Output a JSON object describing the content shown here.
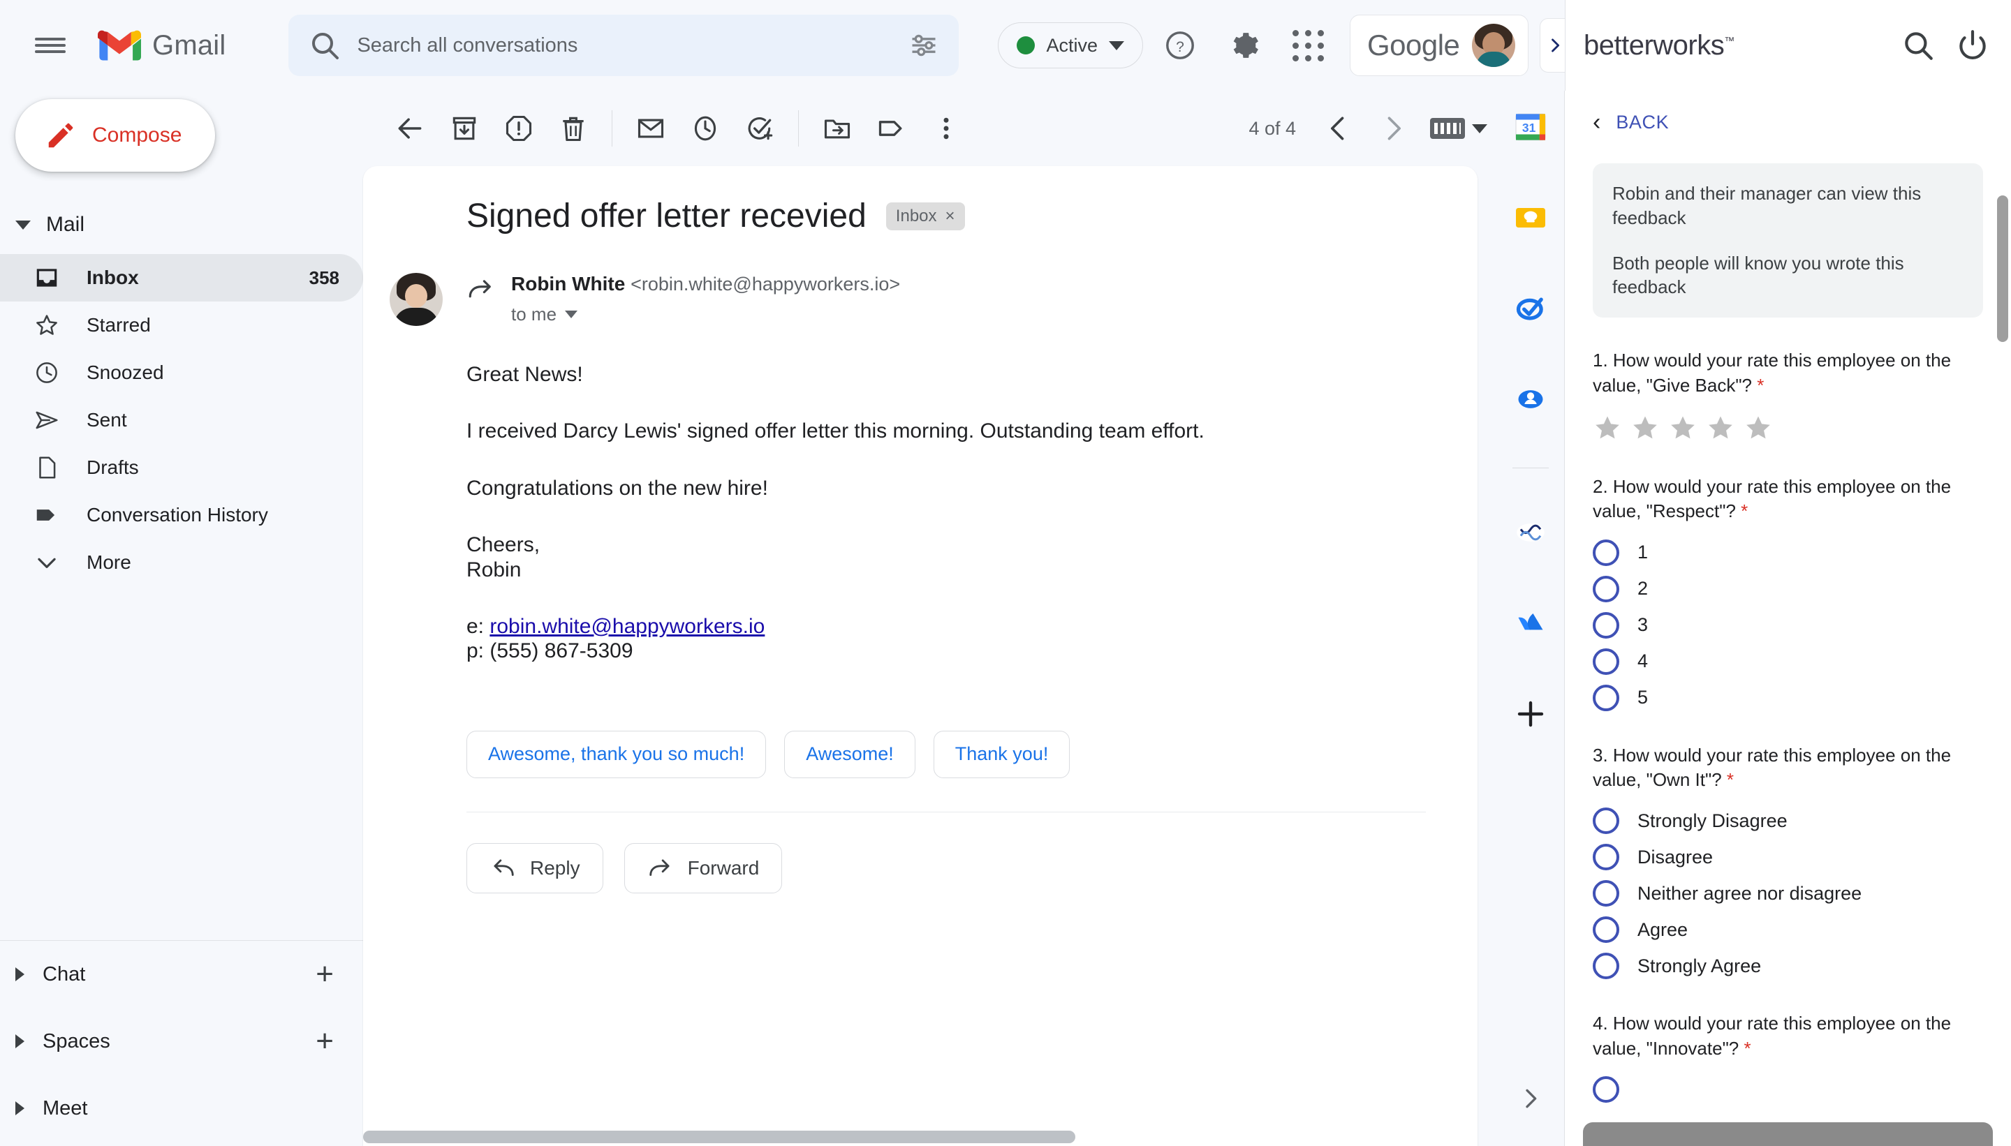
{
  "topbar": {
    "menu_icon": "hamburger-menu-icon",
    "logo_text": "Gmail",
    "search": {
      "icon": "search-icon",
      "placeholder": "Search all conversations",
      "value": "",
      "filter_icon": "tune-filter-icon"
    },
    "status": {
      "label": "Active",
      "color": "#1e8e3e",
      "caret": "chevron-down-icon"
    },
    "help_icon": "help-circle-icon",
    "settings_icon": "gear-icon",
    "apps_icon": "apps-grid-icon",
    "account": {
      "brand": "Google",
      "avatar": "user-avatar"
    },
    "panel_toggle_icon": "chevron-right-icon"
  },
  "sidebar": {
    "compose": {
      "label": "Compose",
      "icon": "pencil-icon"
    },
    "mail_section": {
      "label": "Mail",
      "expanded": true
    },
    "items": [
      {
        "label": "Inbox",
        "count": "358",
        "icon": "inbox-icon",
        "active": true
      },
      {
        "label": "Starred",
        "count": "",
        "icon": "star-icon",
        "active": false
      },
      {
        "label": "Snoozed",
        "count": "",
        "icon": "clock-icon",
        "active": false
      },
      {
        "label": "Sent",
        "count": "",
        "icon": "send-icon",
        "active": false
      },
      {
        "label": "Drafts",
        "count": "",
        "icon": "document-icon",
        "active": false
      },
      {
        "label": "Conversation History",
        "count": "",
        "icon": "label-tag-icon",
        "active": false
      },
      {
        "label": "More",
        "count": "",
        "icon": "chevron-down-icon",
        "active": false
      }
    ],
    "bottom_sections": [
      {
        "label": "Chat",
        "add_icon": "plus-icon",
        "has_add": true
      },
      {
        "label": "Spaces",
        "add_icon": "plus-icon",
        "has_add": true
      },
      {
        "label": "Meet",
        "add_icon": "",
        "has_add": false
      }
    ]
  },
  "mail_toolbar": {
    "back_icon": "arrow-left-icon",
    "archive_icon": "archive-icon",
    "spam_icon": "report-spam-icon",
    "delete_icon": "trash-icon",
    "mark_unread_icon": "envelope-icon",
    "snooze_icon": "clock-icon",
    "add_task_icon": "add-task-icon",
    "move_icon": "move-to-folder-icon",
    "label_icon": "label-tag-icon",
    "more_icon": "more-vertical-icon",
    "pager_text": "4 of 4",
    "prev_icon": "chevron-left-icon",
    "next_icon": "chevron-right-icon",
    "keyboard_icon": "keyboard-icon",
    "keyboard_caret": "chevron-down-icon"
  },
  "message": {
    "subject": "Signed offer letter recevied",
    "label_chip": "Inbox",
    "label_chip_close": "×",
    "sender_name": "Robin White",
    "sender_email": "<robin.white@happyworkers.io>",
    "recipient": "to me",
    "body": {
      "greeting": "Great News!",
      "paragraph": "I received Darcy Lewis' signed offer letter this morning. Outstanding team effort.",
      "congrats": "Congratulations on the new hire!",
      "signoff": "Cheers,",
      "signer": "Robin",
      "email_prefix": "e:",
      "email_link": "robin.white@happyworkers.io",
      "phone": "p: (555) 867-5309"
    },
    "smart_replies": [
      "Awesome, thank you so much!",
      "Awesome!",
      "Thank you!"
    ],
    "reply_button": "Reply",
    "forward_button": "Forward"
  },
  "app_rail": {
    "icons": [
      {
        "name": "google-calendar-icon",
        "label": "31"
      },
      {
        "name": "google-keep-icon",
        "label": ""
      },
      {
        "name": "google-tasks-icon",
        "label": ""
      },
      {
        "name": "google-contacts-icon",
        "label": ""
      },
      {
        "name": "betterworks-addon-icon",
        "label": ""
      },
      {
        "name": "atlassian-addon-icon",
        "label": ""
      },
      {
        "name": "add-addon-icon",
        "label": "+"
      }
    ],
    "expand_icon": "chevron-right-icon"
  },
  "side_panel": {
    "toggle_icon": "chevron-right-icon",
    "logo": "betterworks",
    "logo_tm": "™",
    "search_icon": "search-icon",
    "power_icon": "power-icon",
    "back": {
      "icon": "chevron-left-icon",
      "label": "BACK"
    },
    "notice": [
      "Robin and their manager can view this feedback",
      "Both people will know you wrote this feedback"
    ],
    "accent_color": "#3f51b5",
    "required_color": "#d93025",
    "questions": [
      {
        "text": "1. How would your rate this employee on the value, \"Give Back\"?",
        "required": "*",
        "type": "stars",
        "star_count": 5,
        "selected": 0,
        "options": []
      },
      {
        "text": "2. How would your rate this employee on the value, \"Respect\"?",
        "required": "*",
        "type": "radio",
        "options": [
          "1",
          "2",
          "3",
          "4",
          "5"
        ]
      },
      {
        "text": "3. How would your rate this employee on the value, \"Own It\"?",
        "required": "*",
        "type": "radio",
        "options": [
          "Strongly Disagree",
          "Disagree",
          "Neither agree nor disagree",
          "Agree",
          "Strongly Agree"
        ]
      },
      {
        "text": "4. How would your rate this employee on the value, \"Innovate\"?",
        "required": "*",
        "type": "radio",
        "options": []
      }
    ]
  }
}
